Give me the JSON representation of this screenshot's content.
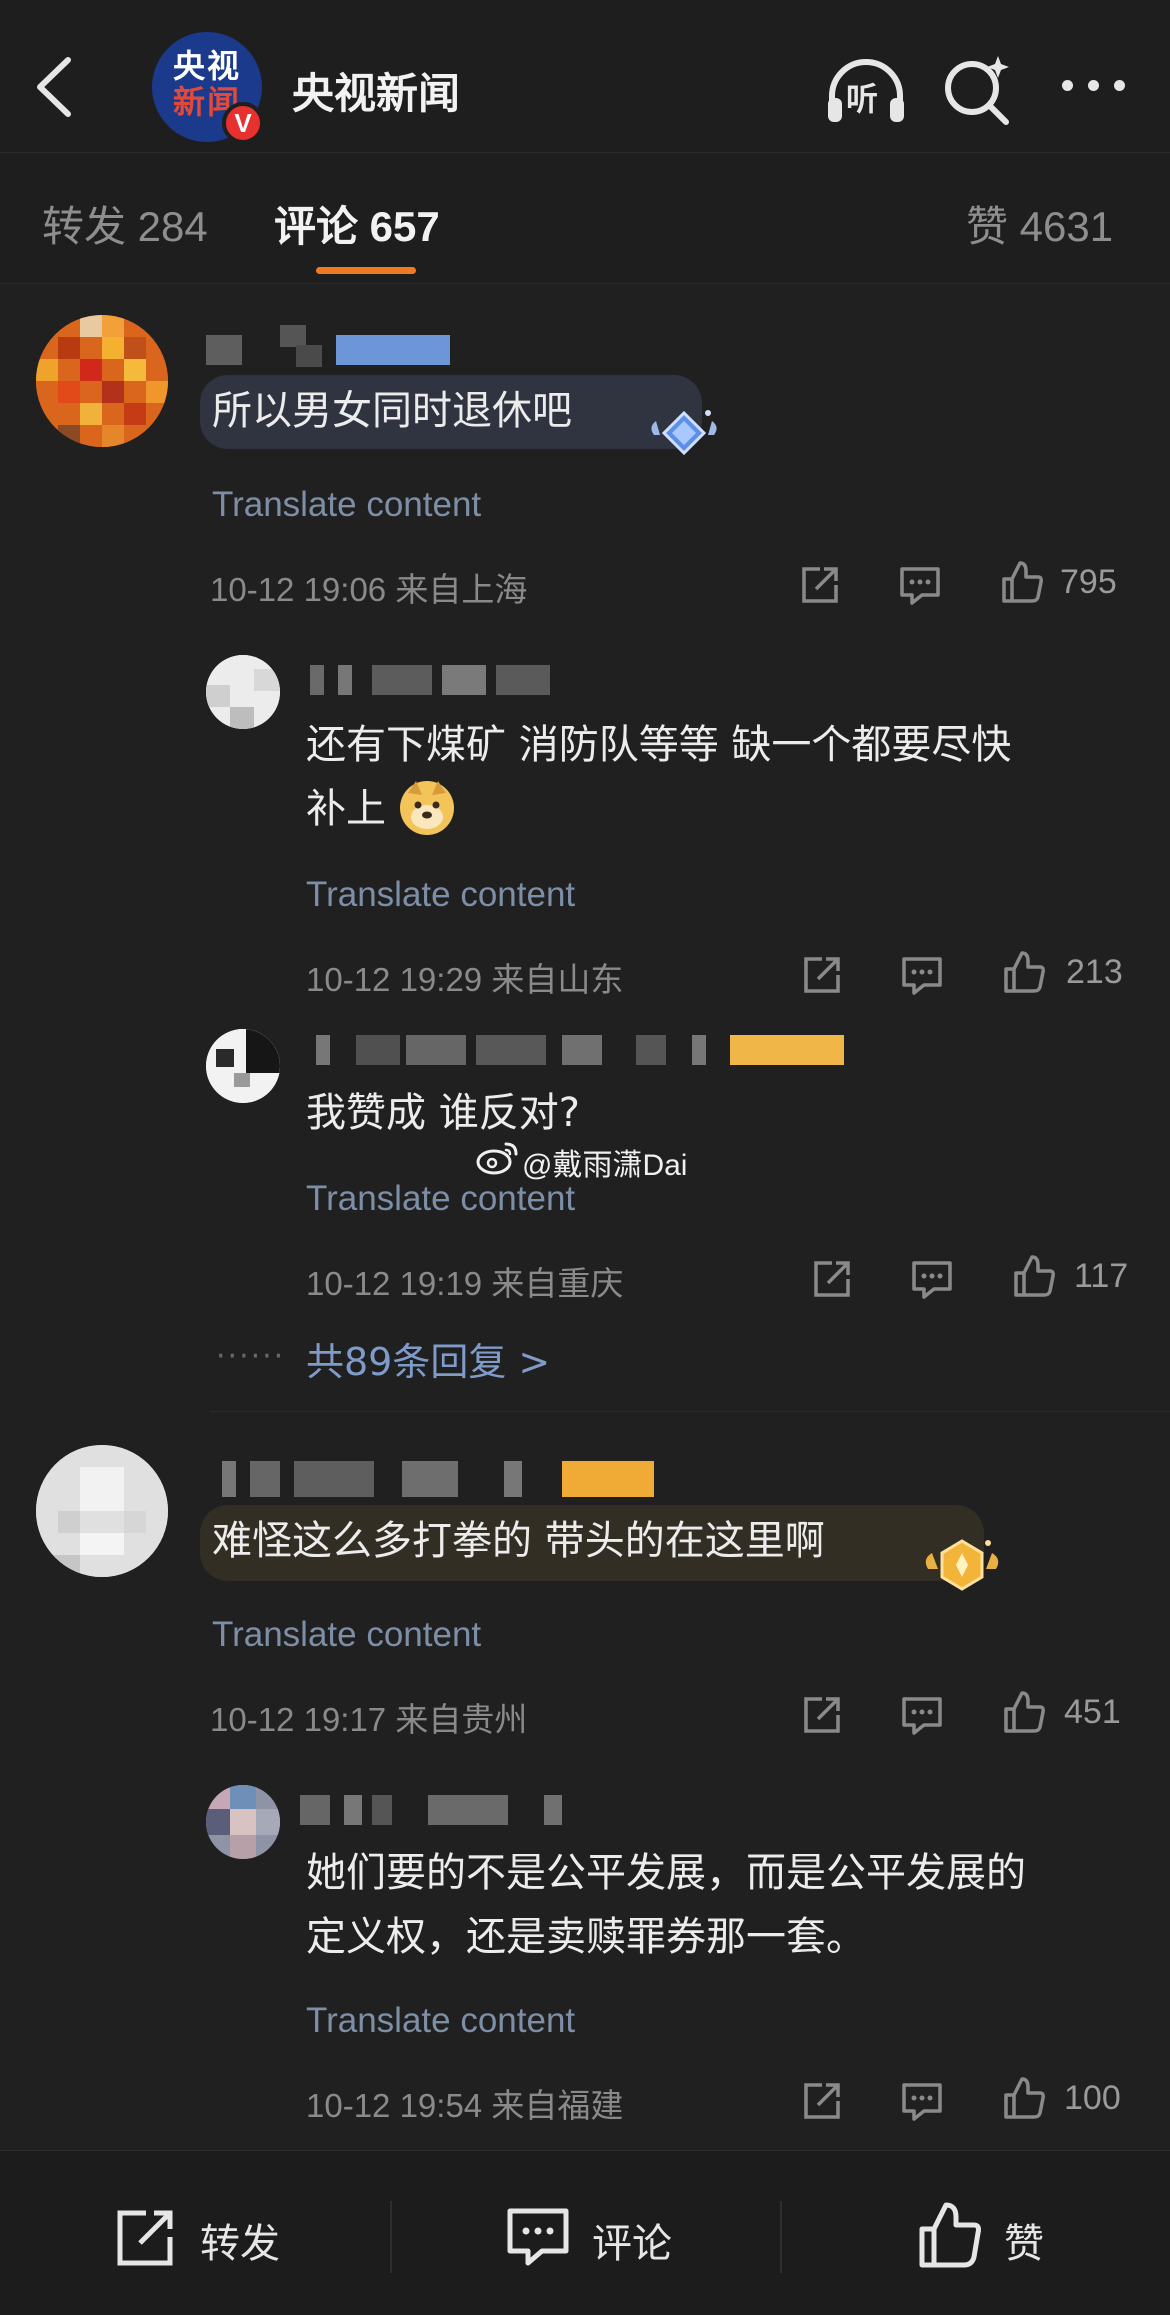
{
  "header": {
    "account_name": "央视新闻",
    "logo_line1": "央视",
    "logo_line2": "新闻",
    "verified_badge": "V",
    "listen_label": "听",
    "icons": [
      "back-icon",
      "headphones-icon",
      "search-icon",
      "more-icon"
    ]
  },
  "tabs": [
    {
      "label": "转发 284",
      "active": false
    },
    {
      "label": "评论 657",
      "active": true
    },
    {
      "label": "赞 4631",
      "active": false
    }
  ],
  "accent_color": "#f07a23",
  "watermark": "@戴雨潇Dai",
  "comments": [
    {
      "text": "所以男女同时退休吧",
      "translate": "Translate content",
      "meta": "10-12 19:06 来自上海",
      "likes": "795",
      "badge_icon": "diamond-badge-icon",
      "replies": [
        {
          "text_line1": "还有下煤矿 消防队等等 缺一个都要尽快",
          "text_line2": "补上",
          "emoji": "doge-emoji-icon",
          "translate": "Translate content",
          "meta": "10-12 19:29 来自山东",
          "likes": "213"
        },
        {
          "text_line1": "我赞成 谁反对?",
          "translate": "Translate content",
          "meta": "10-12 19:19 来自重庆",
          "likes": "117"
        }
      ],
      "more_replies": "共89条回复 >",
      "more_dots": "······"
    },
    {
      "text": "难怪这么多打拳的 带头的在这里啊",
      "translate": "Translate content",
      "meta": "10-12 19:17 来自贵州",
      "likes": "451",
      "badge_icon": "gold-badge-icon",
      "replies": [
        {
          "text_line1": "她们要的不是公平发展，而是公平发展的",
          "text_line2": "定义权，还是卖赎罪券那一套。",
          "translate": "Translate content",
          "meta": "10-12 19:54 来自福建",
          "likes": "100"
        }
      ]
    }
  ],
  "bottom_bar": {
    "repost": "转发",
    "comment": "评论",
    "like": "赞"
  }
}
